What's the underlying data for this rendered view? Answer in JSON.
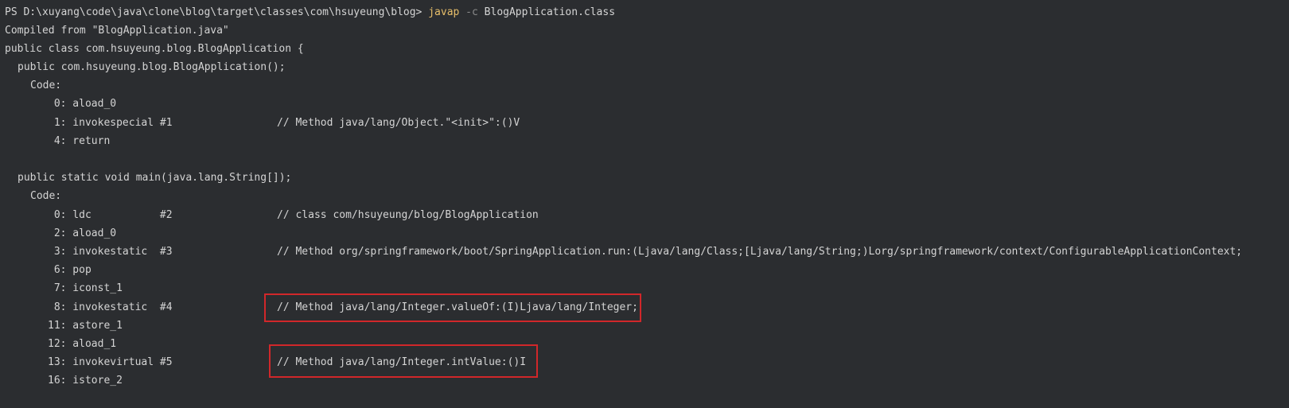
{
  "prompt": {
    "path": "PS D:\\xuyang\\code\\java\\clone\\blog\\target\\classes\\com\\hsuyeung\\blog> ",
    "command": "javap",
    "flag": " -c ",
    "arg": "BlogApplication.class"
  },
  "lines": {
    "compiled_from": "Compiled from \"BlogApplication.java\"",
    "class_decl": "public class com.hsuyeung.blog.BlogApplication {",
    "ctor_decl": "public com.hsuyeung.blog.BlogApplication();",
    "code1": "Code:",
    "c1_0": " 0: aload_0",
    "c1_1": " 1: invokespecial #1",
    "c1_1_comment": "// Method java/lang/Object.\"<init>\":()V",
    "c1_4": " 4: return",
    "main_decl": "public static void main(java.lang.String[]);",
    "code2": "Code:",
    "c2_0": " 0: ldc           #2",
    "c2_0_comment": "// class com/hsuyeung/blog/BlogApplication",
    "c2_2": " 2: aload_0",
    "c2_3": " 3: invokestatic  #3",
    "c2_3_comment": "// Method org/springframework/boot/SpringApplication.run:(Ljava/lang/Class;[Ljava/lang/String;)Lorg/springframework/context/ConfigurableApplicationContext;",
    "c2_6": " 6: pop",
    "c2_7": " 7: iconst_1",
    "c2_8": " 8: invokestatic  #4",
    "c2_8_comment": "// Method java/lang/Integer.valueOf:(I)Ljava/lang/Integer;",
    "c2_11": "11: astore_1",
    "c2_12": "12: aload_1",
    "c2_13": "13: invokevirtual #5",
    "c2_13_comment": "// Method java/lang/Integer.intValue:()I",
    "c2_16": "16: istore_2"
  },
  "colors": {
    "background": "#2b2d30",
    "text": "#d4d4d4",
    "command": "#e8bf6a",
    "highlight": "#d1272a"
  }
}
